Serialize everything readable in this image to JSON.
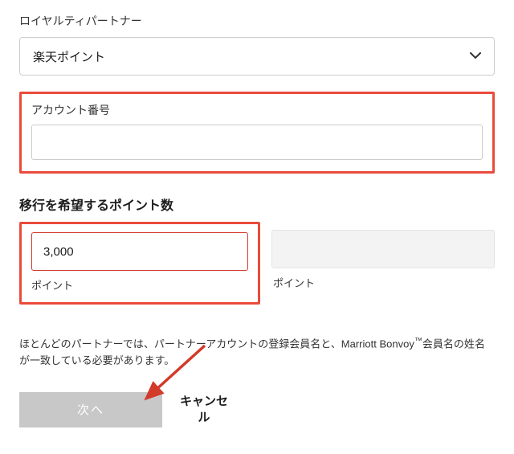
{
  "loyalty_partner": {
    "label": "ロイヤルティパートナー",
    "selected": "楽天ポイント"
  },
  "account_number": {
    "label": "アカウント番号",
    "value": ""
  },
  "points_transfer": {
    "heading": "移行を希望するポイント数",
    "source_value": "3,000",
    "source_unit": "ポイント",
    "target_value": "",
    "target_unit": "ポイント"
  },
  "disclaimer": {
    "text_prefix": "ほとんどのパートナーでは、パートナーアカウントの登録会員名と、Marriott Bonvoy",
    "tm": "™",
    "text_suffix": "会員名の姓名が一致している必要があります。"
  },
  "buttons": {
    "next": "次へ",
    "cancel": "キャンセル"
  }
}
